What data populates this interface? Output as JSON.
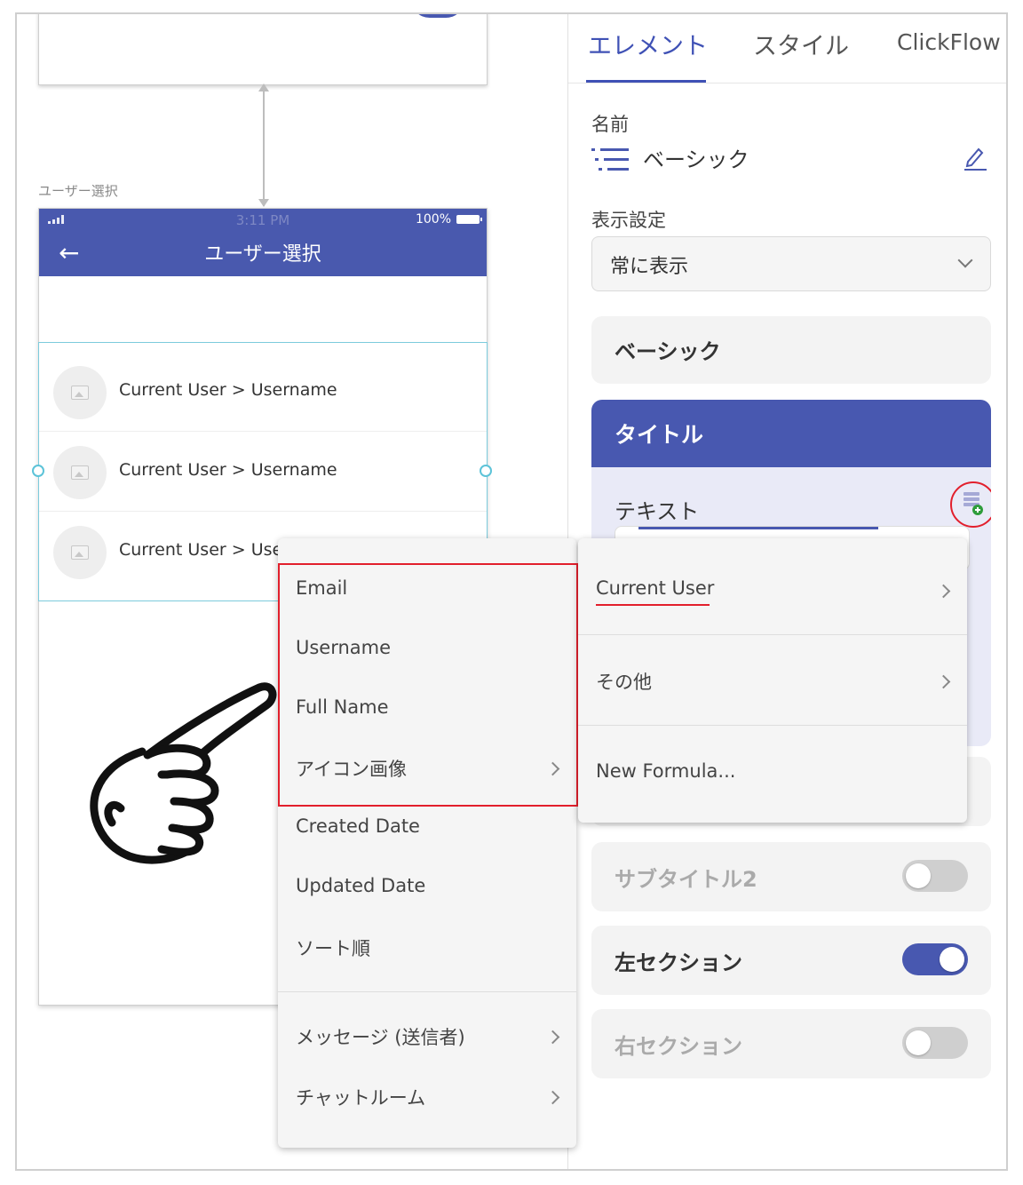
{
  "canvas": {
    "screen_caption": "ユーザー選択",
    "phone": {
      "status_time": "3:11 PM",
      "battery": "100%",
      "nav_title": "ユーザー選択",
      "back_icon": "back-arrow-icon",
      "rows": [
        {
          "text": "Current User > Username"
        },
        {
          "text": "Current User > Username"
        },
        {
          "text": "Current User > Username"
        }
      ]
    }
  },
  "panel": {
    "tabs": [
      {
        "label": "エレメント",
        "active": true
      },
      {
        "label": "スタイル",
        "active": false
      },
      {
        "label": "ClickFlow",
        "active": false
      }
    ],
    "name_label": "名前",
    "name_value": "ベーシック",
    "display_label": "表示設定",
    "display_value": "常に表示",
    "basic_card": "ベーシック",
    "title_card": {
      "header": "タイトル",
      "text_label": "テキスト"
    },
    "subtitle2": {
      "label": "サブタイトル2",
      "enabled": false
    },
    "left_section": {
      "label": "左セクション",
      "enabled": true
    },
    "right_section": {
      "label": "右セクション",
      "enabled": false
    },
    "accent_color": "#4858b0",
    "highlight_color": "#e21f2c"
  },
  "menu_fields": {
    "items": [
      {
        "label": "Email",
        "has_submenu": false
      },
      {
        "label": "Username",
        "has_submenu": false
      },
      {
        "label": "Full Name",
        "has_submenu": false
      },
      {
        "label": "アイコン画像",
        "has_submenu": true
      },
      {
        "label": "Created Date",
        "has_submenu": false
      },
      {
        "label": "Updated Date",
        "has_submenu": false
      },
      {
        "label": "ソート順",
        "has_submenu": false
      }
    ],
    "relations": [
      {
        "label": "メッセージ (送信者)",
        "has_submenu": true
      },
      {
        "label": "チャットルーム",
        "has_submenu": true
      }
    ]
  },
  "menu_sources": {
    "items": [
      {
        "label": "Current User",
        "has_submenu": true
      },
      {
        "label": "その他",
        "has_submenu": true
      },
      {
        "label": "New Formula...",
        "has_submenu": false
      }
    ]
  }
}
